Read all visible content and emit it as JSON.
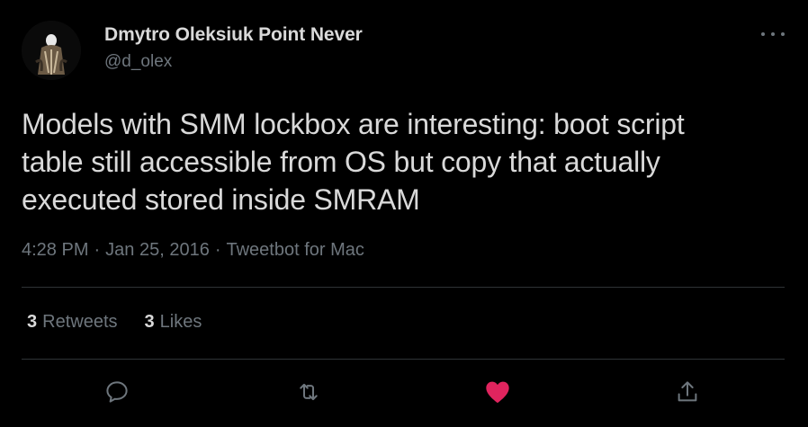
{
  "author": {
    "name": "Dmytro Oleksiuk Point Never",
    "handle": "@d_olex"
  },
  "tweet": {
    "text_lines": [
      "Models with SMM lockbox are interesting: boot script",
      "table still accessible from OS but copy that actually",
      "executed stored inside SMRAM"
    ]
  },
  "meta": {
    "time": "4:28 PM",
    "separator": "·",
    "date": "Jan 25, 2016",
    "source": "Tweetbot for Mac"
  },
  "stats": {
    "retweets_count": "3",
    "retweets_label": "Retweets",
    "likes_count": "3",
    "likes_label": "Likes"
  },
  "actions": {
    "reply_icon": "reply-icon",
    "retweet_icon": "retweet-icon",
    "like_icon": "heart-icon",
    "share_icon": "share-icon",
    "liked": true
  },
  "colors": {
    "background": "#000000",
    "text_primary": "#d9d9d9",
    "text_secondary": "#6e767d",
    "divider": "#2f3336",
    "like_active": "#e0245e"
  }
}
